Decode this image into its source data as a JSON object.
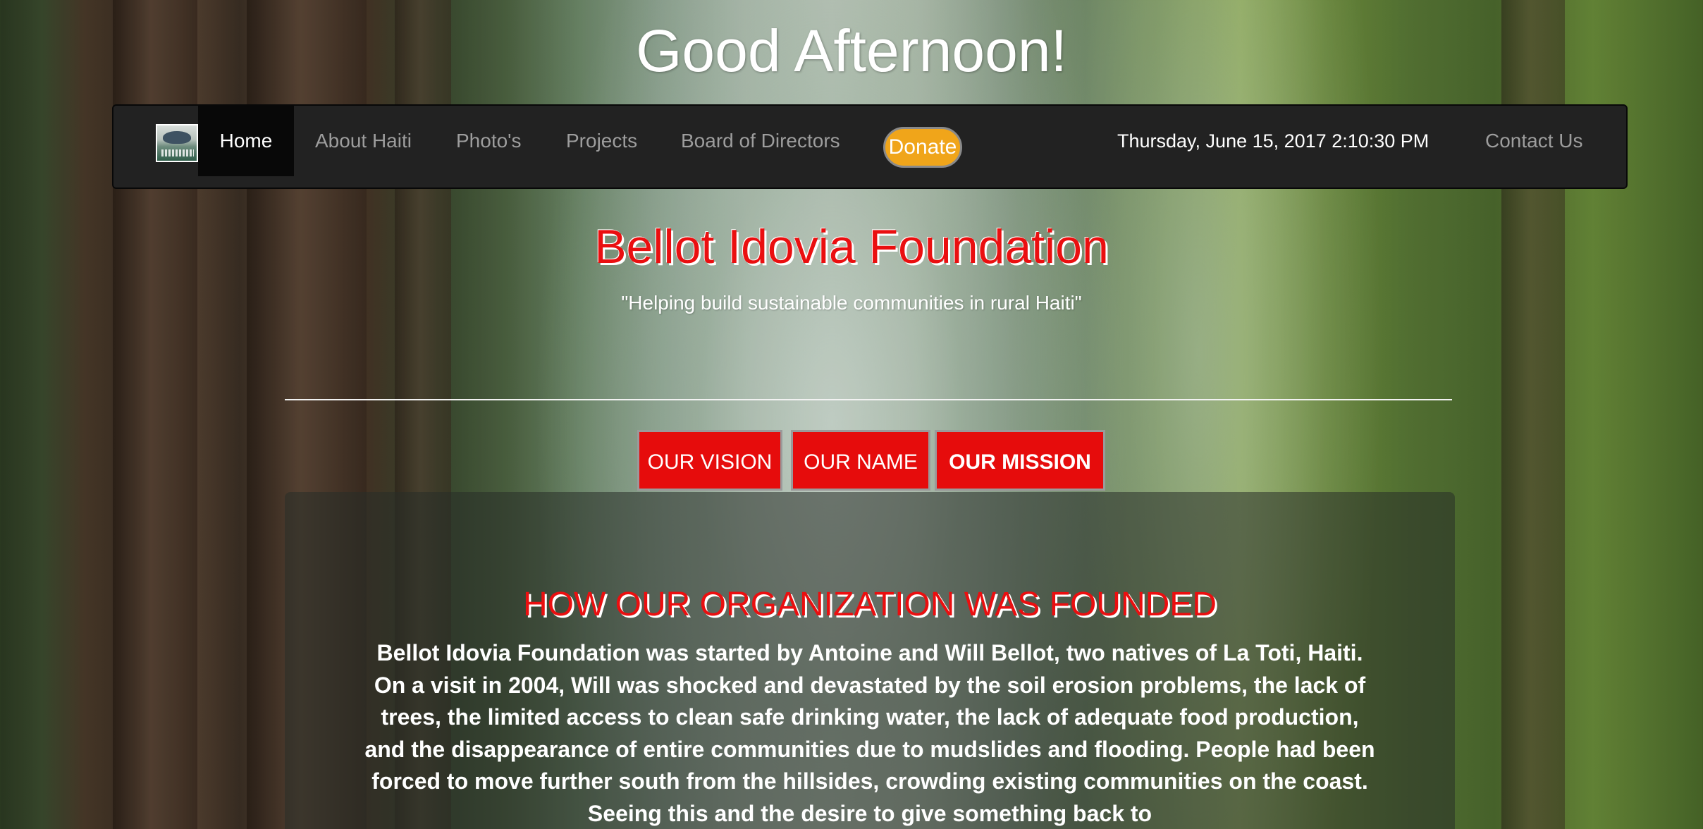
{
  "greeting": "Good Afternoon!",
  "navbar": {
    "brand_logo": "Bellot Idovia Foundation logo",
    "items": [
      {
        "label": "Home",
        "active": true
      },
      {
        "label": "About Haiti"
      },
      {
        "label": "Photo's"
      },
      {
        "label": "Projects"
      },
      {
        "label": "Board of Directors"
      }
    ],
    "donate_label": "Donate",
    "datetime": "Thursday, June 15, 2017 2:10:30 PM",
    "contact_label": "Contact Us"
  },
  "header": {
    "title": "Bellot Idovia Foundation",
    "tagline": "\"Helping build sustainable communities in rural Haiti\""
  },
  "tabs": [
    {
      "label": "OUR VISION"
    },
    {
      "label": "OUR NAME"
    },
    {
      "label": "OUR MISSION",
      "active": true
    }
  ],
  "panel": {
    "heading": "HOW OUR ORGANIZATION WAS FOUNDED",
    "body": "Bellot Idovia Foundation was started by Antoine and Will Bellot, two natives of La Toti, Haiti. On a visit in 2004, Will was shocked and devastated by the soil erosion problems, the lack of trees, the limited access to clean safe drinking water, the lack of adequate food production, and the disappearance of entire communities due to mudslides and flooding. People had been forced to move further south from the hillsides, crowding existing communities on the coast. Seeing this and the desire to give something back to"
  },
  "colors": {
    "navbar_bg": "#222222",
    "nav_active_bg": "#080808",
    "donate": "#f0a51a",
    "accent_red": "#ea0f10",
    "tab_red": "#e60c0c"
  }
}
